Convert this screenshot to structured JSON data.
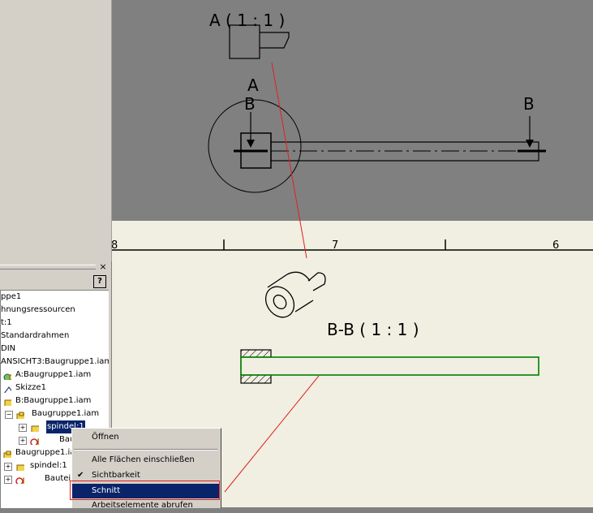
{
  "drawing": {
    "view_a_label": "A  ( 1 : 1 )",
    "section_a_marker": "A",
    "section_b_marker_left": "B",
    "section_b_marker_right": "B",
    "view_bb_label": "B-B  ( 1 : 1 )",
    "ruler_marks": [
      "8",
      "7",
      "6"
    ]
  },
  "browser": {
    "close_glyph": "×",
    "help_glyph": "?",
    "tree": [
      {
        "label": "ppe1"
      },
      {
        "label": "hnungsressourcen"
      },
      {
        "label": "t:1"
      },
      {
        "label": "Standardrahmen"
      },
      {
        "label": "DIN"
      },
      {
        "label": "ANSICHT3:Baugruppe1.iam"
      },
      {
        "label": "A:Baugruppe1.iam"
      },
      {
        "label": "Skizze1"
      },
      {
        "label": "B:Baugruppe1.iam"
      },
      {
        "label": "Baugruppe1.iam"
      },
      {
        "label": "spindel:1"
      },
      {
        "label": "Bau"
      },
      {
        "label": "Baugruppe1.ia"
      },
      {
        "label": "spindel:1"
      },
      {
        "label": "Bauteil"
      }
    ]
  },
  "context_menu": {
    "items": [
      {
        "label": "Öffnen"
      },
      {
        "label": "Alle Flächen einschließen"
      },
      {
        "label": "Sichtbarkeit",
        "checked": true
      },
      {
        "label": "Schnitt"
      },
      {
        "label": "Arbeitselemente abrufen"
      }
    ]
  },
  "colors": {
    "accent_red": "#e02020",
    "selection": "#0a246a",
    "section_green": "#008000"
  }
}
